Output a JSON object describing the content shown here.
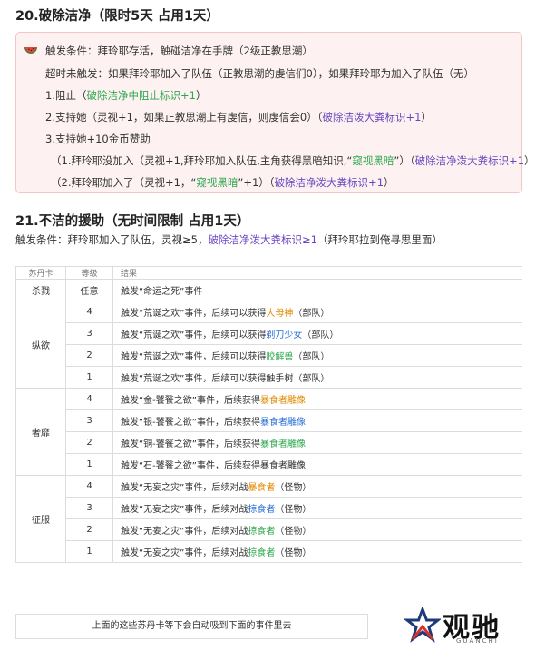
{
  "section20": {
    "title": "20.破除洁净（限时5天 占用1天）",
    "trigger": "触发条件：拜玲耶存活，触碰洁净在手牌（2级正教思潮）",
    "timeout": "超时未触发：如果拜玲耶加入了队伍（正教思潮的虔信们0），如果拜玲耶为加入了队伍（无）",
    "opt1_text": "1.阻止（",
    "opt1_tag": "破除洁净中阻止标识+1",
    "opt1_end": "）",
    "opt2_text": "2.支持她（灵视+1，如果正教思潮上有虔信，则虔信会0）（",
    "opt2_tag": "破除洁泼大粪标识+1",
    "opt2_end": "）",
    "opt3_text": "3.支持她+10金币赞助",
    "sub1_text": "（1.拜玲耶没加入（灵视+1,拜玲耶加入队伍,主角获得黑暗知识,“",
    "sub1_tag1": "窥视黑暗",
    "sub1_mid": "”）（",
    "sub1_tag2": "破除洁净泼大粪标识+1",
    "sub1_end": "）",
    "sub2_text": "（2.拜玲耶加入了（灵视+1，“",
    "sub2_tag1": "窥视黑暗",
    "sub2_mid": "”+1）（",
    "sub2_tag2": "破除洁净泼大粪标识+1",
    "sub2_end": "）"
  },
  "section21": {
    "title": "21.不洁的援助（无时间限制 占用1天）",
    "trigger_text": "触发条件：拜玲耶加入了队伍，灵视≥5，",
    "trigger_tag": "破除洁净泼大粪标识≥1",
    "trigger_end": "（拜玲耶拉到俺寻思里面）"
  },
  "table": {
    "headers": [
      "苏丹卡",
      "等级",
      "结果"
    ],
    "kill": {
      "cat": "杀戮",
      "level": "任意",
      "text": "触发“命运之死”事件"
    },
    "indulge": {
      "cat": "纵欲",
      "rows": [
        {
          "level": "4",
          "pre": "触发“荒诞之欢”事件，后续可以获得",
          "tag": "大母神",
          "post": "（部队）"
        },
        {
          "level": "3",
          "pre": "触发“荒诞之欢”事件，后续可以获得",
          "tag": "剃刀少女",
          "post": "（部队）"
        },
        {
          "level": "2",
          "pre": "触发“荒诞之欢”事件，后续可以获得",
          "tag": "胶解兽",
          "post": "（部队）"
        },
        {
          "level": "1",
          "pre": "触发“荒诞之欢”事件，后续可以获得触手树",
          "tag": "",
          "post": "（部队）"
        }
      ]
    },
    "luxury": {
      "cat": "奢靡",
      "rows": [
        {
          "level": "4",
          "pre": "触发“金-饕餮之欲”事件，后续获得",
          "tag": "暴食者雕像"
        },
        {
          "level": "3",
          "pre": "触发“银-饕餮之欲”事件，后续获得",
          "tag": "暴食者雕像"
        },
        {
          "level": "2",
          "pre": "触发“铜-饕餮之欲”事件，后续获得",
          "tag": "暴食者雕像"
        },
        {
          "level": "1",
          "pre": "触发“石-饕餮之欲”事件，后续获得",
          "tag": "暴食者雕像"
        }
      ]
    },
    "conquest": {
      "cat": "征服",
      "rows": [
        {
          "level": "4",
          "pre": "触发“无妄之灾”事件，后续对战",
          "tag": "暴食者",
          "post": "（怪物）"
        },
        {
          "level": "3",
          "pre": "触发“无妄之灾”事件，后续对战",
          "tag": "掠食者",
          "post": "（怪物）"
        },
        {
          "level": "2",
          "pre": "触发“无妄之灾”事件，后续对战",
          "tag": "掠食者",
          "post": "（怪物）"
        },
        {
          "level": "1",
          "pre": "触发“无妄之灾”事件，后续对战",
          "tag": "掠食者",
          "post": "（怪物）"
        }
      ]
    },
    "footer": "上面的这些苏丹卡等下会自动吸到下面的事件里去"
  },
  "logo": {
    "text": "观驰",
    "sub": "GUANCHI"
  }
}
